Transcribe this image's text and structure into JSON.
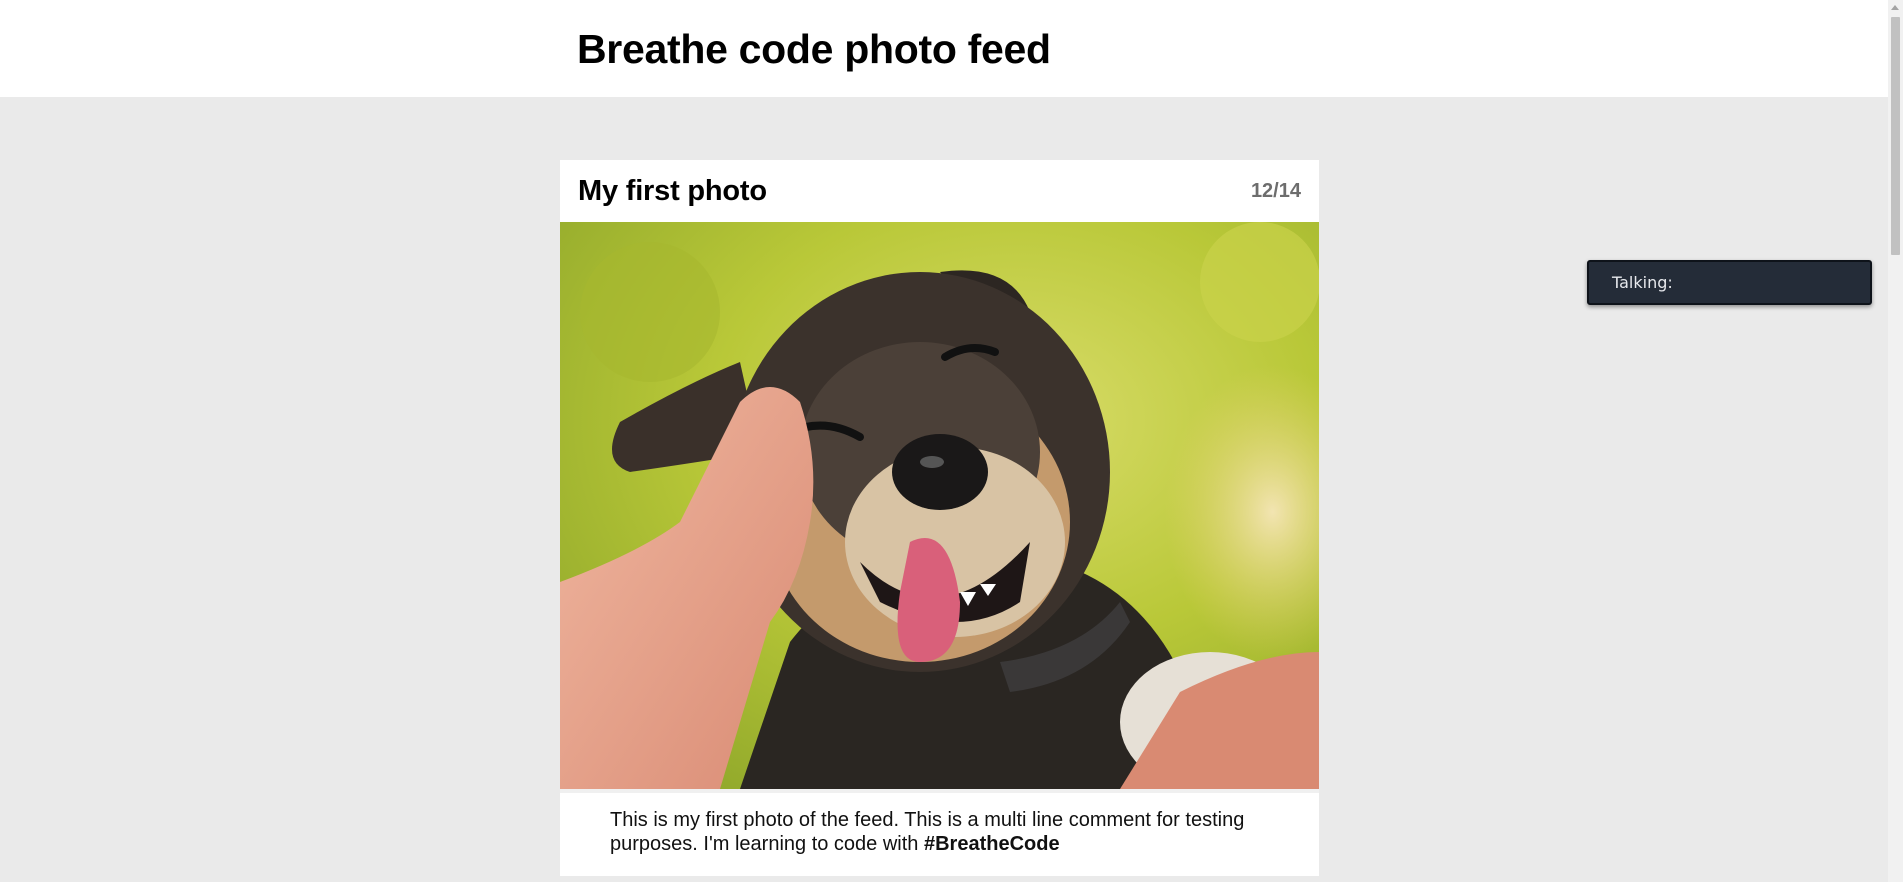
{
  "header": {
    "title": "Breathe code photo feed"
  },
  "post": {
    "title": "My first photo",
    "counter": "12/14",
    "photo_alt": "Smiling dog being petted",
    "caption_text": "This is my first photo of the feed. This is a multi line comment for testing purposes. I'm learning to code with ",
    "caption_hashtag": "#BreatheCode"
  },
  "talk_widget": {
    "label": "Talking:"
  },
  "colors": {
    "page_background": "#eaeaea",
    "card_background": "#ffffff",
    "counter_text": "#6d6d6d",
    "talk_background": "#242c38"
  }
}
